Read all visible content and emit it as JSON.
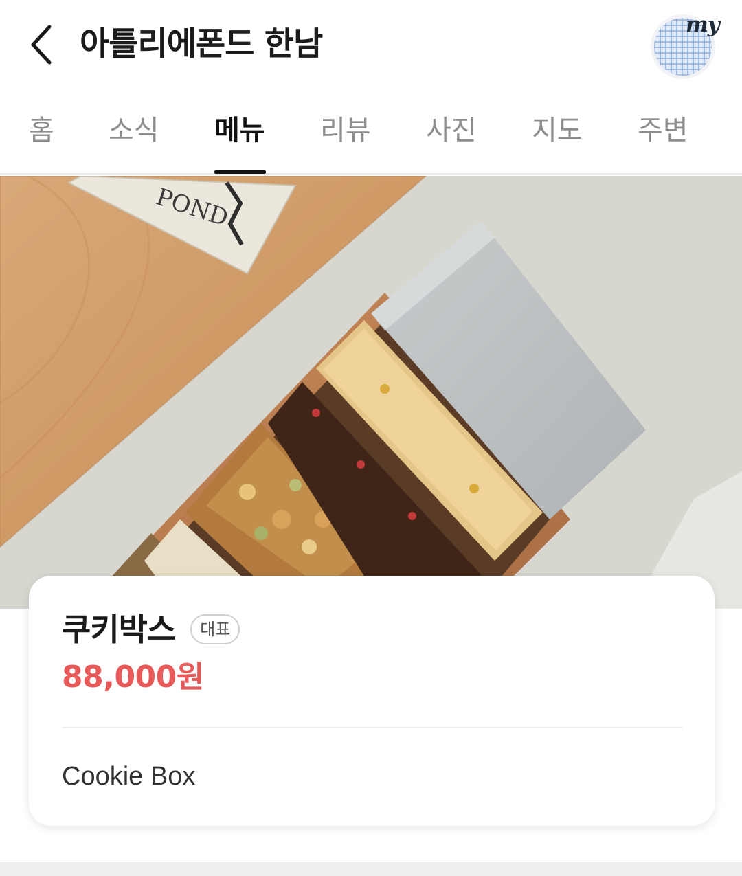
{
  "header": {
    "title": "아틀리에폰드 한남",
    "my_label": "my"
  },
  "tabs": [
    {
      "label": "홈"
    },
    {
      "label": "소식"
    },
    {
      "label": "메뉴",
      "active": true
    },
    {
      "label": "리뷰"
    },
    {
      "label": "사진"
    },
    {
      "label": "지도"
    },
    {
      "label": "주변"
    }
  ],
  "menu_item": {
    "name": "쿠키박스",
    "badge": "대표",
    "price": "88,000원",
    "description": "Cookie Box"
  },
  "colors": {
    "price": "#e85a5a",
    "active_tab": "#111111",
    "inactive_tab": "#8d8d8d"
  },
  "icons": [
    "back-arrow-icon",
    "my-profile-icon"
  ]
}
